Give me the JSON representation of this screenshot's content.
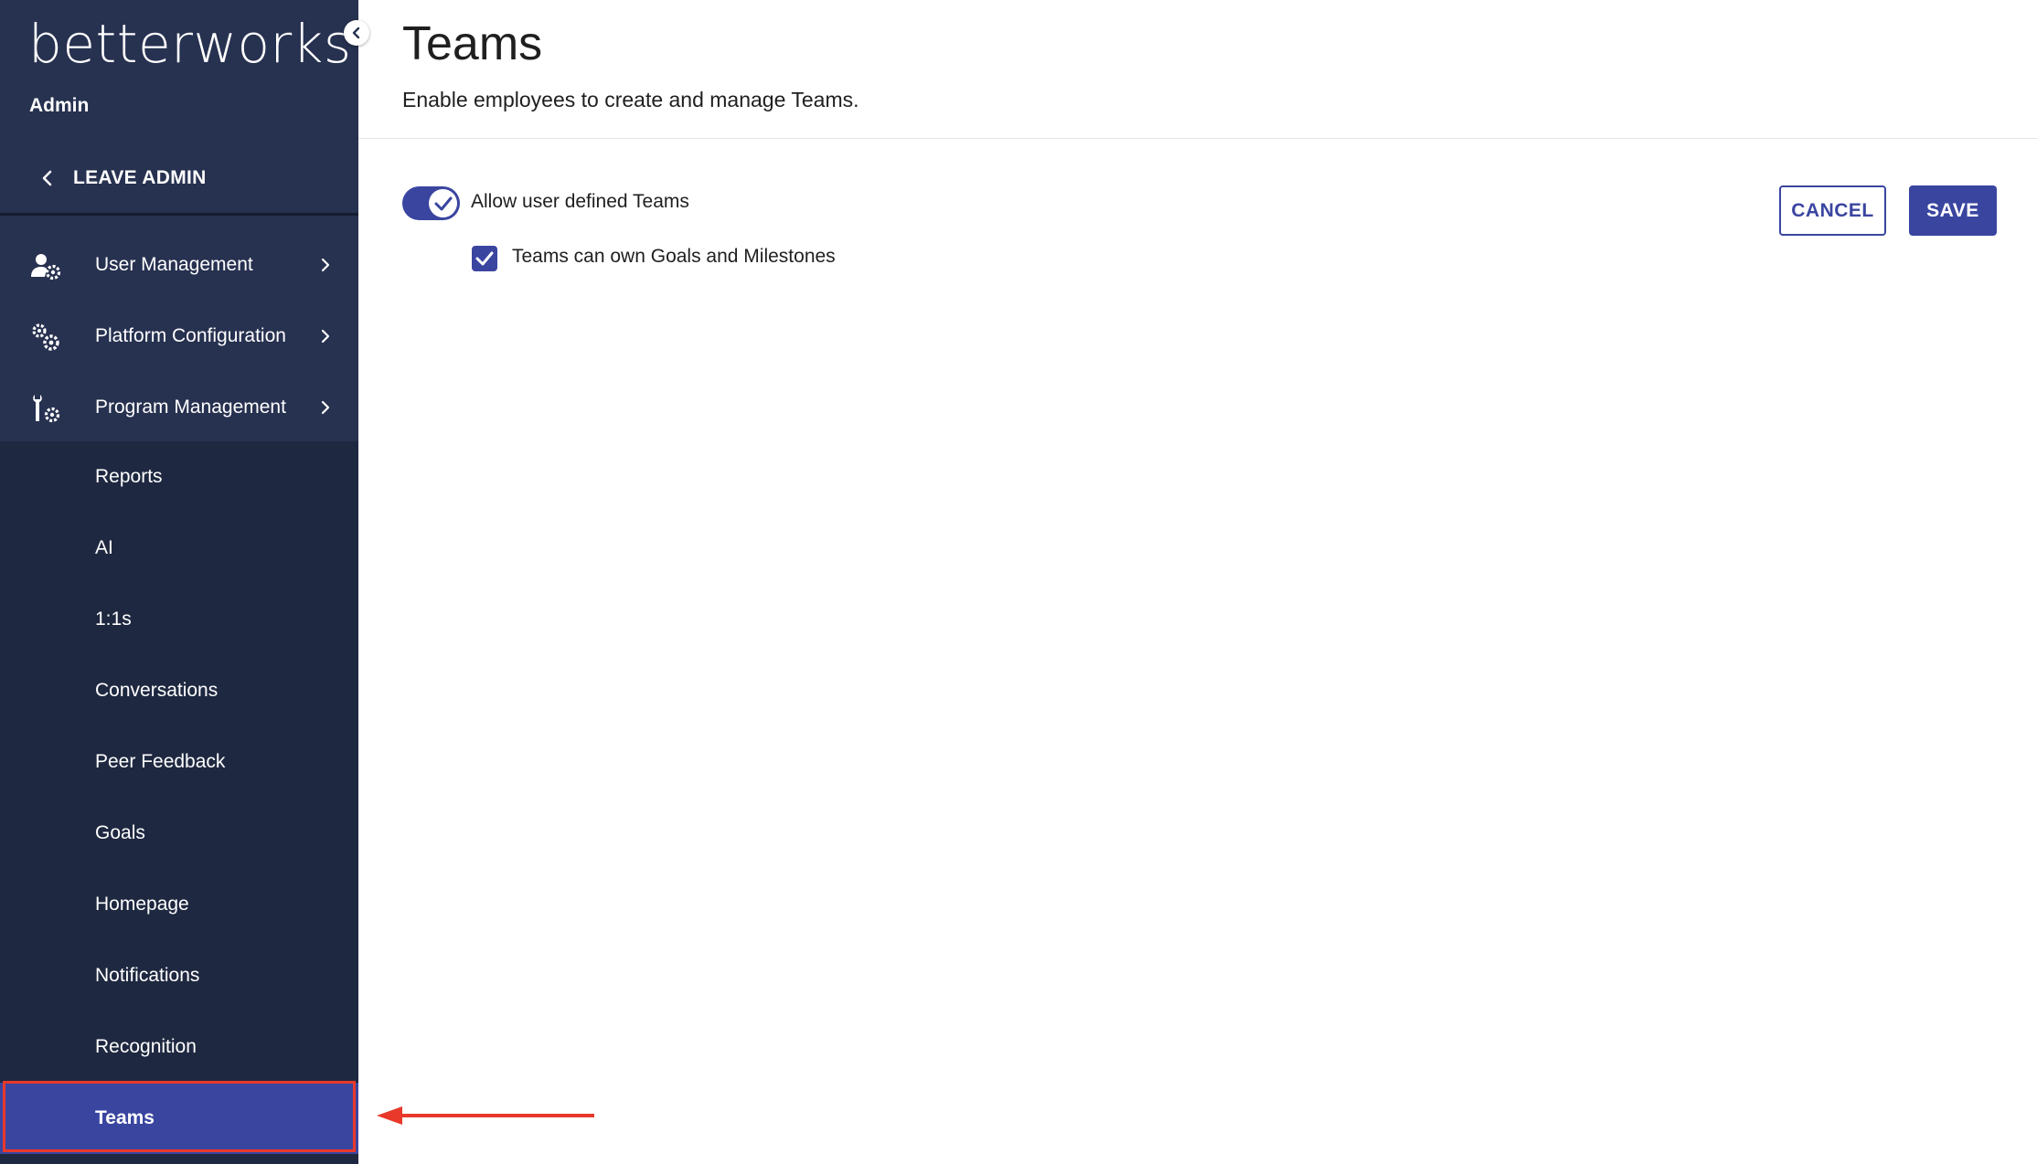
{
  "brand": {
    "logo_text": "betterworks"
  },
  "sidebar": {
    "section_label": "Admin",
    "leave_admin_label": "LEAVE ADMIN",
    "primary_items": [
      {
        "label": "User Management",
        "icon": "user-gear-icon"
      },
      {
        "label": "Platform Configuration",
        "icon": "gears-icon"
      },
      {
        "label": "Program Management",
        "icon": "wrench-gear-icon"
      }
    ],
    "sub_items": [
      {
        "label": "Reports"
      },
      {
        "label": "AI"
      },
      {
        "label": "1:1s"
      },
      {
        "label": "Conversations"
      },
      {
        "label": "Peer Feedback"
      },
      {
        "label": "Goals"
      },
      {
        "label": "Homepage"
      },
      {
        "label": "Notifications"
      },
      {
        "label": "Recognition"
      },
      {
        "label": "Teams",
        "active": true
      }
    ]
  },
  "page": {
    "title": "Teams",
    "subtitle": "Enable employees to create and manage Teams."
  },
  "settings": {
    "toggle_label": "Allow user defined Teams",
    "toggle_on": true,
    "checkbox_label": "Teams can own Goals and Milestones",
    "checkbox_checked": true
  },
  "actions": {
    "cancel_label": "CANCEL",
    "save_label": "SAVE"
  },
  "colors": {
    "sidebar_bg": "#1e2840",
    "sidebar_header_bg": "#273150",
    "accent": "#3a45a0",
    "annotation": "#e8392a"
  }
}
